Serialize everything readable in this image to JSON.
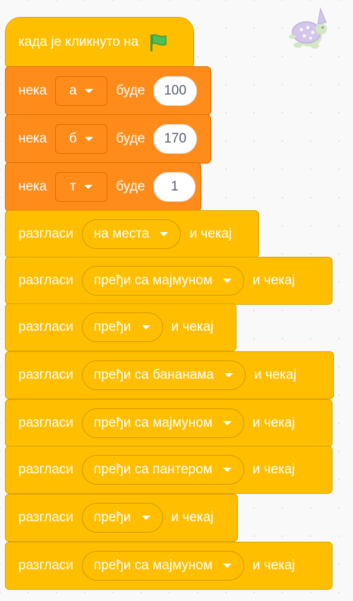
{
  "script": {
    "hat": {
      "text": "када је кликнуто на",
      "icon": "green-flag-icon"
    },
    "set_blocks": [
      {
        "label": "нека",
        "variable": "а",
        "to_label": "буде",
        "value": "100"
      },
      {
        "label": "нека",
        "variable": "б",
        "to_label": "буде",
        "value": "170"
      },
      {
        "label": "нека",
        "variable": "т",
        "to_label": "буде",
        "value": "1"
      }
    ],
    "broadcast_blocks": [
      {
        "label": "разгласи",
        "message": "на места",
        "suffix": "и чекај"
      },
      {
        "label": "разгласи",
        "message": "пређи са мајмуном",
        "suffix": "и чекај"
      },
      {
        "label": "разгласи",
        "message": "пређи",
        "suffix": "и чекај"
      },
      {
        "label": "разгласи",
        "message": "пређи са бананама",
        "suffix": "и чекај"
      },
      {
        "label": "разгласи",
        "message": "пређи са мајмуном",
        "suffix": "и чекај"
      },
      {
        "label": "разгласи",
        "message": "пређи са пантером",
        "suffix": "и чекај"
      },
      {
        "label": "разгласи",
        "message": "пређи",
        "suffix": "и чекај"
      },
      {
        "label": "разгласи",
        "message": "пређи са мајмуном",
        "suffix": "и чекај"
      }
    ]
  },
  "sprite": {
    "icon": "turtle-sprite-thumbnail"
  },
  "colors": {
    "events": "#ffbf00",
    "variables": "#ff8c1a",
    "flag": "#4cbf56"
  }
}
